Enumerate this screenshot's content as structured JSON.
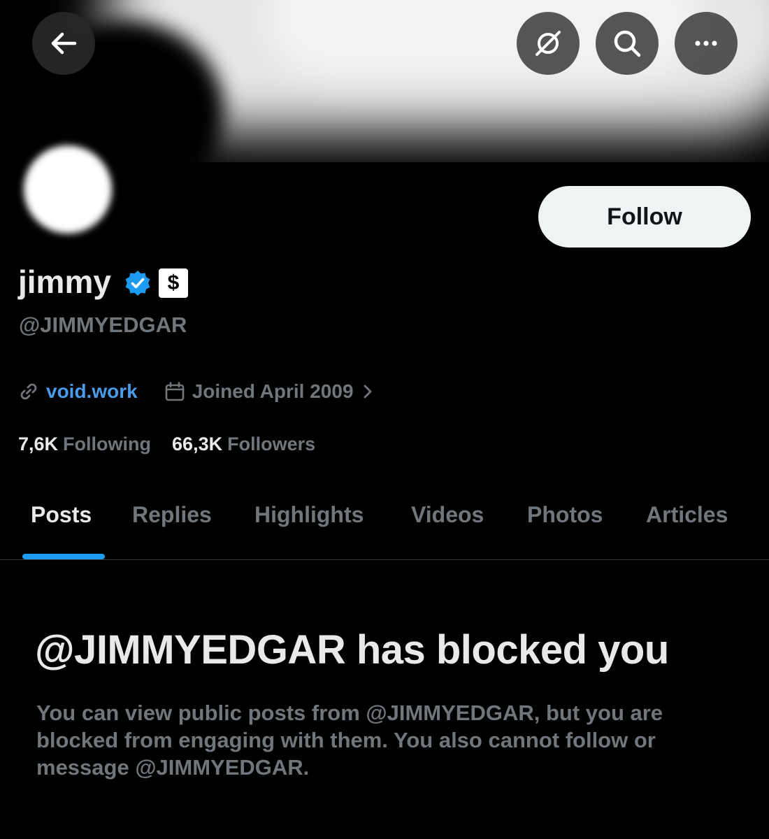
{
  "header": {
    "back_icon": "arrow-left-icon",
    "grok_icon": "slashed-circle-icon",
    "search_icon": "search-icon",
    "more_icon": "more-dots-icon"
  },
  "profile": {
    "display_name": "jimmy",
    "verified_icon": "verified-badge-icon",
    "affiliate_badge": "$",
    "handle": "@JIMMYEDGAR",
    "follow_label": "Follow",
    "website": "void.work",
    "joined": "Joined April 2009",
    "following_count": "7,6K",
    "following_label": "Following",
    "followers_count": "66,3K",
    "followers_label": "Followers"
  },
  "tabs": [
    {
      "label": "Posts",
      "active": true
    },
    {
      "label": "Replies",
      "active": false
    },
    {
      "label": "Highlights",
      "active": false
    },
    {
      "label": "Videos",
      "active": false
    },
    {
      "label": "Photos",
      "active": false
    },
    {
      "label": "Articles",
      "active": false
    }
  ],
  "blocked": {
    "title": "@JIMMYEDGAR has blocked you",
    "description": "You can view public posts from @JIMMYEDGAR, but you are blocked from engaging with them. You also cannot follow or message @JIMMYEDGAR."
  },
  "colors": {
    "background": "#000000",
    "accent": "#1d9bf0",
    "muted_text": "#71767b",
    "primary_text": "#e7e9ea"
  }
}
